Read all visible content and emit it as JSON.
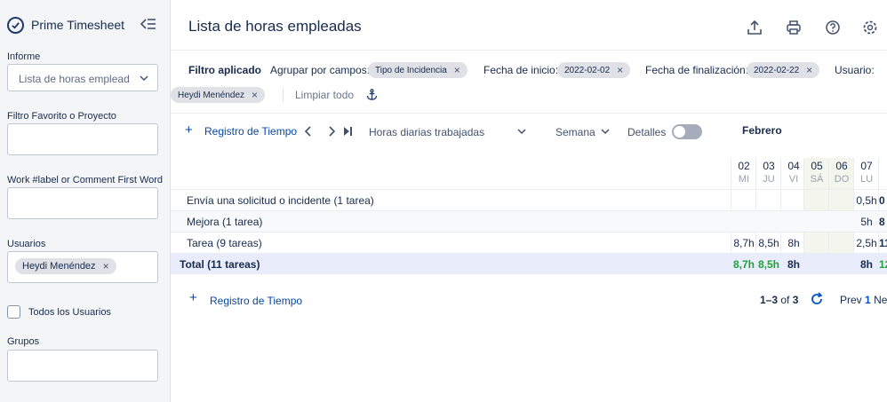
{
  "sidebar": {
    "app_title": "Prime Timesheet",
    "informe_label": "Informe",
    "informe_value": "Lista de horas emplead",
    "favorito_label": "Filtro Favorito o Proyecto",
    "work_label": "Work #label or Comment First Word",
    "usuarios_label": "Usuarios",
    "usuario_chip": "Heydi Menéndez",
    "todos_label": "Todos los Usuarios",
    "grupos_label": "Grupos"
  },
  "header": {
    "title": "Lista de horas empleadas",
    "icons": [
      "upload-icon",
      "print-icon",
      "help-icon",
      "settings-icon"
    ]
  },
  "filters": {
    "applied_label": "Filtro aplicado",
    "group_label": "Agrupar por campos:",
    "group_chip": "Tipo de Incidencia",
    "start_label": "Fecha de inicio:",
    "start_chip": "2022-02-02",
    "end_label": "Fecha de finalización:",
    "end_chip": "2022-02-22",
    "user_label": "Usuario:",
    "user_chip": "Heydi Menéndez",
    "clear_all": "Limpiar todo"
  },
  "toolbar": {
    "add_time": "Registro de Tiempo",
    "view_select": "Horas diarias trabajadas",
    "period_select": "Semana",
    "details_label": "Detalles",
    "month": "Febrero"
  },
  "days": [
    {
      "num": "02",
      "wd": "MI"
    },
    {
      "num": "03",
      "wd": "JU"
    },
    {
      "num": "04",
      "wd": "VI"
    },
    {
      "num": "05",
      "wd": "SÁ"
    },
    {
      "num": "06",
      "wd": "DO"
    },
    {
      "num": "07",
      "wd": "LU"
    }
  ],
  "rows": [
    {
      "label": "Envía una solicitud o incidente   (1 tarea)",
      "cells": [
        "",
        "",
        "",
        "",
        "",
        "0,5h"
      ],
      "trail": "0"
    },
    {
      "label": "Mejora   (1 tarea)",
      "cells": [
        "",
        "",
        "",
        "",
        "",
        "5h"
      ],
      "trail": "8"
    },
    {
      "label": "Tarea   (9 tareas)",
      "cells": [
        "8,7h",
        "8,5h",
        "8h",
        "",
        "",
        "2,5h"
      ],
      "trail": "11"
    },
    {
      "label": "Total (11 tareas)",
      "cells": [
        "8,7h",
        "8,5h",
        "8h",
        "",
        "",
        "8h"
      ],
      "trail": "12"
    }
  ],
  "footer": {
    "add_time": "Registro de Tiempo",
    "range": "1–3",
    "of": "of",
    "total_pages": "3",
    "prev": "Prev",
    "page": "1",
    "next": "Ne"
  }
}
